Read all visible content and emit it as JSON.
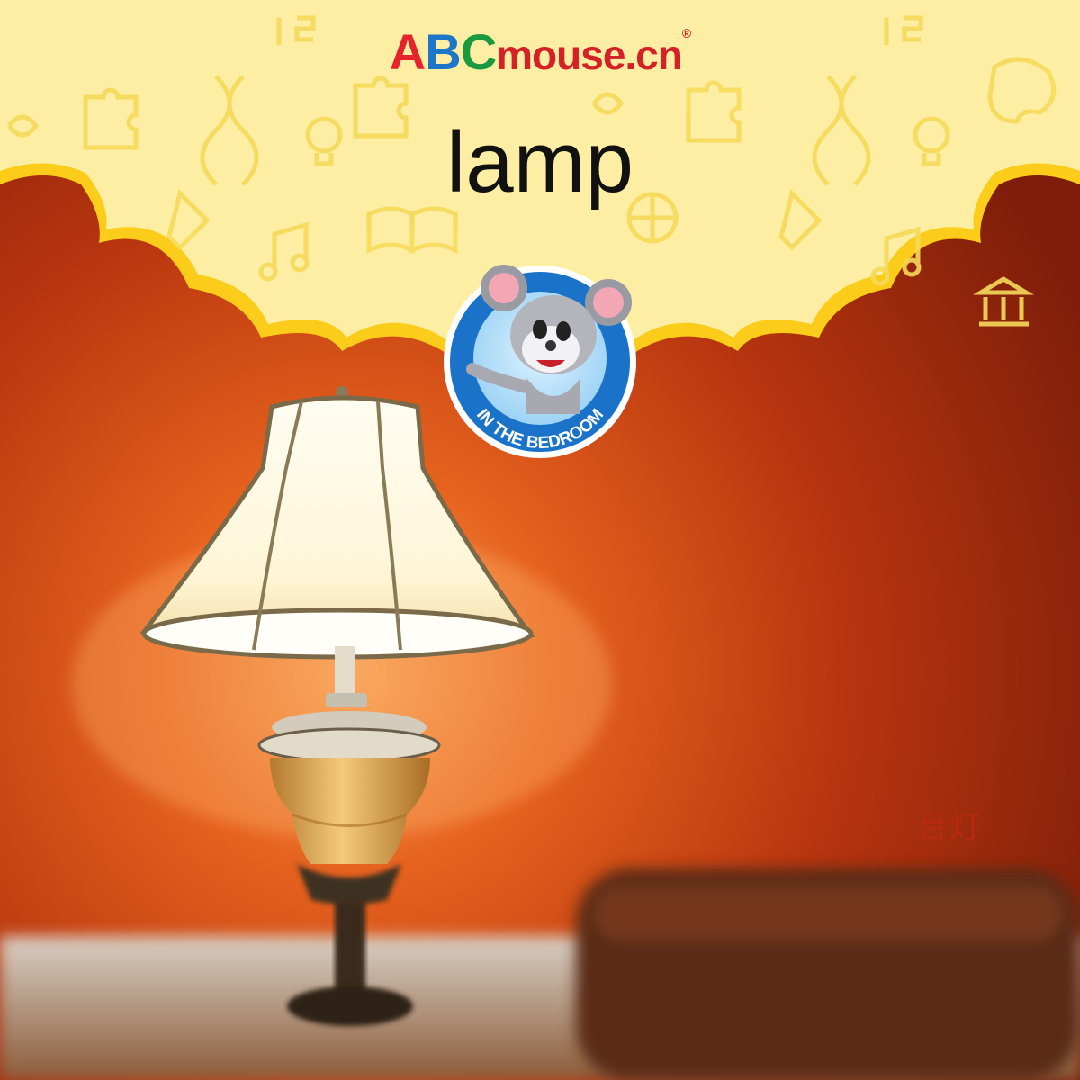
{
  "logo": {
    "letter_a": "A",
    "letter_b": "B",
    "letter_c": "C",
    "rest": "mouse.cn",
    "registered": "®"
  },
  "word": "lamp",
  "translation": "台灯",
  "badge": {
    "label": "IN THE BEDROOM"
  },
  "colors": {
    "banner_fill": "#fdeea3",
    "banner_border": "#fbcd1a",
    "wall": "#b8350f",
    "badge_ring": "#1a73c8"
  },
  "icons": [
    "puzzle-icon",
    "dna-icon",
    "lightbulb-icon",
    "book-icon",
    "music-note-icon",
    "globe-icon",
    "test-tube-icon",
    "palette-icon",
    "museum-icon",
    "abc-icon",
    "123-icon"
  ]
}
